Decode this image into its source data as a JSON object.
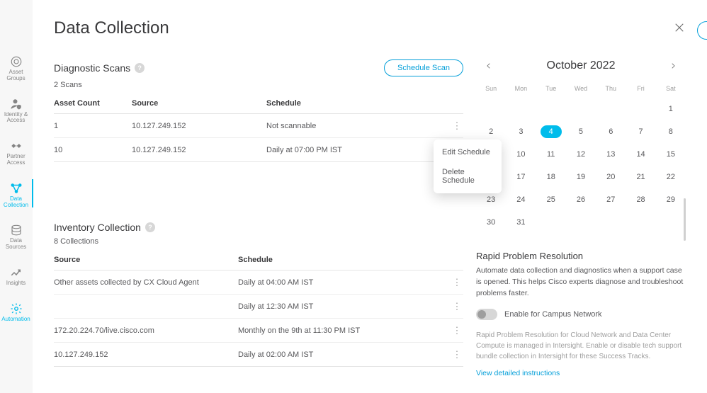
{
  "page": {
    "title": "Data Collection"
  },
  "sidebar": {
    "items": [
      {
        "label": "Asset\nGroups"
      },
      {
        "label": "Identity &\nAccess"
      },
      {
        "label": "Partner\nAccess"
      },
      {
        "label": "Data\nCollection"
      },
      {
        "label": "Data\nSources"
      },
      {
        "label": "Insights"
      },
      {
        "label": "Automation"
      }
    ]
  },
  "diagnostic": {
    "title": "Diagnostic Scans",
    "schedule_button": "Schedule Scan",
    "count_label": "2 Scans",
    "columns": {
      "asset_count": "Asset Count",
      "source": "Source",
      "schedule": "Schedule"
    },
    "rows": [
      {
        "asset_count": "1",
        "source": "10.127.249.152",
        "schedule": "Not scannable"
      },
      {
        "asset_count": "10",
        "source": "10.127.249.152",
        "schedule": "Daily at 07:00 PM IST"
      }
    ]
  },
  "menu": {
    "edit": "Edit Schedule",
    "delete": "Delete Schedule"
  },
  "inventory": {
    "title": "Inventory Collection",
    "count_label": "8 Collections",
    "columns": {
      "source": "Source",
      "schedule": "Schedule"
    },
    "rows": [
      {
        "source": "Other assets collected by CX Cloud Agent",
        "schedule": "Daily at 04:00 AM IST"
      },
      {
        "source": "",
        "schedule": "Daily at 12:30 AM IST"
      },
      {
        "source": "172.20.224.70/live.cisco.com",
        "schedule": "Monthly on the 9th at 11:30 PM IST"
      },
      {
        "source": "10.127.249.152",
        "schedule": "Daily at 02:00 AM IST"
      }
    ]
  },
  "calendar": {
    "title": "October 2022",
    "dow": [
      "Sun",
      "Mon",
      "Tue",
      "Wed",
      "Thu",
      "Fri",
      "Sat"
    ],
    "leading_blanks": 6,
    "days": 31,
    "selected": 4
  },
  "rpr": {
    "title": "Rapid Problem Resolution",
    "desc": "Automate data collection and diagnostics when a support case is opened. This helps Cisco experts diagnose and troubleshoot problems faster.",
    "toggle_label": "Enable for Campus Network",
    "hint": "Rapid Problem Resolution for Cloud Network and Data Center Compute is managed in Intersight. Enable or disable tech support bundle collection in Intersight for these Success Tracks.",
    "link": "View detailed instructions"
  }
}
